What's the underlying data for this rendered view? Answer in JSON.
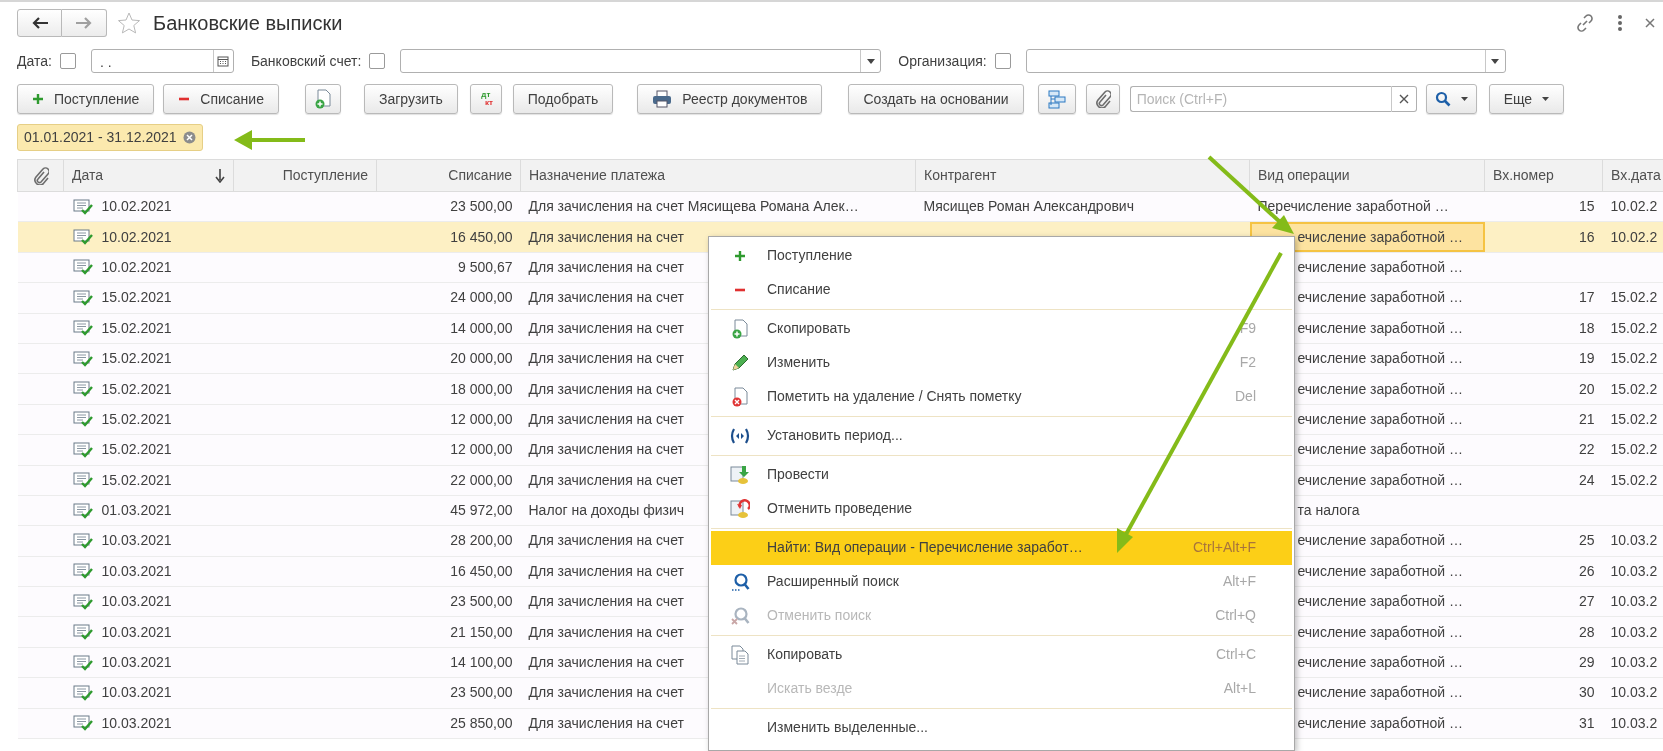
{
  "window": {
    "title": "Банковские выписки",
    "favorite": false
  },
  "nav": [
    {
      "kind": "back",
      "disabled": false
    },
    {
      "kind": "forward",
      "disabled": true
    }
  ],
  "filters": [
    {
      "kind": "date",
      "label": "Дата:",
      "checked": false,
      "value": ". ."
    },
    {
      "kind": "combo",
      "label": "Банковский счет:",
      "checked": false
    },
    {
      "kind": "combo",
      "label": "Организация:",
      "checked": false
    }
  ],
  "toolbar": [
    {
      "kind": "add",
      "label": "Поступление"
    },
    {
      "kind": "remove",
      "label": "Списание"
    },
    {
      "kind": "copy-doc"
    },
    {
      "kind": "text",
      "label": "Загрузить"
    },
    {
      "kind": "dtkt",
      "icon_text": [
        "дт",
        "кт"
      ]
    },
    {
      "kind": "text",
      "label": "Подобрать"
    },
    {
      "kind": "print",
      "label": "Реестр документов"
    },
    {
      "kind": "text",
      "label": "Создать на основании"
    },
    {
      "kind": "structure"
    },
    {
      "kind": "attach"
    },
    {
      "kind": "search",
      "placeholder": "Поиск (Ctrl+F)"
    },
    {
      "kind": "search-menu"
    },
    {
      "kind": "more",
      "label": "Еще"
    }
  ],
  "period_filter": {
    "label": "01.01.2021 - 31.12.2021"
  },
  "table": {
    "columns": [
      {
        "kind": "attach"
      },
      {
        "kind": "text",
        "label": "Дата",
        "sorted": true
      },
      {
        "kind": "text",
        "label": "Поступление"
      },
      {
        "kind": "text",
        "label": "Списание"
      },
      {
        "kind": "text",
        "label": "Назначение платежа"
      },
      {
        "kind": "text",
        "label": "Контрагент"
      },
      {
        "kind": "text",
        "label": "Вид операции"
      },
      {
        "kind": "text",
        "label": "Вх.номер"
      },
      {
        "kind": "text",
        "label": "Вх.дата"
      }
    ],
    "rows": [
      {
        "date": "10.02.2021",
        "debit": "23 500,00",
        "purpose": "Для зачисления на счет Мясищева Романа Алек…",
        "counterparty": "Мясищев Роман Александрович",
        "operation": "Перечисление заработной …",
        "in_number": "15",
        "in_date": "10.02.2",
        "selected": false
      },
      {
        "date": "10.02.2021",
        "debit": "16 450,00",
        "purpose": "Для зачисления на счет",
        "operation": "ечисление заработной …",
        "in_number": "16",
        "in_date": "10.02.2",
        "selected": true
      },
      {
        "date": "10.02.2021",
        "debit": "9 500,67",
        "purpose": "Для зачисления на счет",
        "operation": "ечисление заработной …",
        "selected": false
      },
      {
        "date": "15.02.2021",
        "debit": "24 000,00",
        "purpose": "Для зачисления на счет",
        "operation": "ечисление заработной …",
        "in_number": "17",
        "in_date": "15.02.2",
        "selected": false
      },
      {
        "date": "15.02.2021",
        "debit": "14 000,00",
        "purpose": "Для зачисления на счет",
        "operation": "ечисление заработной …",
        "in_number": "18",
        "in_date": "15.02.2",
        "selected": false
      },
      {
        "date": "15.02.2021",
        "debit": "20 000,00",
        "purpose": "Для зачисления на счет",
        "operation": "ечисление заработной …",
        "in_number": "19",
        "in_date": "15.02.2",
        "selected": false
      },
      {
        "date": "15.02.2021",
        "debit": "18 000,00",
        "purpose": "Для зачисления на счет",
        "operation": "ечисление заработной …",
        "in_number": "20",
        "in_date": "15.02.2",
        "selected": false
      },
      {
        "date": "15.02.2021",
        "debit": "12 000,00",
        "purpose": "Для зачисления на счет",
        "operation": "ечисление заработной …",
        "in_number": "21",
        "in_date": "15.02.2",
        "selected": false
      },
      {
        "date": "15.02.2021",
        "debit": "12 000,00",
        "purpose": "Для зачисления на счет",
        "operation": "ечисление заработной …",
        "in_number": "22",
        "in_date": "15.02.2",
        "selected": false
      },
      {
        "date": "15.02.2021",
        "debit": "22 000,00",
        "purpose": "Для зачисления на счет",
        "operation": "ечисление заработной …",
        "in_number": "24",
        "in_date": "15.02.2",
        "selected": false
      },
      {
        "date": "01.03.2021",
        "debit": "45 972,00",
        "purpose": "Налог на доходы физич",
        "operation": "та налога",
        "selected": false
      },
      {
        "date": "10.03.2021",
        "debit": "28 200,00",
        "purpose": "Для зачисления на счет",
        "operation": "ечисление заработной …",
        "in_number": "25",
        "in_date": "10.03.2",
        "selected": false
      },
      {
        "date": "10.03.2021",
        "debit": "16 450,00",
        "purpose": "Для зачисления на счет",
        "operation": "ечисление заработной …",
        "in_number": "26",
        "in_date": "10.03.2",
        "selected": false
      },
      {
        "date": "10.03.2021",
        "debit": "23 500,00",
        "purpose": "Для зачисления на счет",
        "operation": "ечисление заработной …",
        "in_number": "27",
        "in_date": "10.03.2",
        "selected": false
      },
      {
        "date": "10.03.2021",
        "debit": "21 150,00",
        "purpose": "Для зачисления на счет",
        "operation": "ечисление заработной …",
        "in_number": "28",
        "in_date": "10.03.2",
        "selected": false
      },
      {
        "date": "10.03.2021",
        "debit": "14 100,00",
        "purpose": "Для зачисления на счет",
        "operation": "ечисление заработной …",
        "in_number": "29",
        "in_date": "10.03.2",
        "selected": false
      },
      {
        "date": "10.03.2021",
        "debit": "23 500,00",
        "purpose": "Для зачисления на счет",
        "operation": "ечисление заработной …",
        "in_number": "30",
        "in_date": "10.03.2",
        "selected": false
      },
      {
        "date": "10.03.2021",
        "debit": "25 850,00",
        "purpose": "Для зачисления на счет",
        "operation": "ечисление заработной …",
        "in_number": "31",
        "in_date": "10.03.2",
        "selected": false
      }
    ]
  },
  "context_menu": {
    "groups": [
      [
        {
          "kind": "add",
          "label": "Поступление",
          "selected": false,
          "disabled": false
        },
        {
          "kind": "remove",
          "label": "Списание",
          "selected": false,
          "disabled": false
        }
      ],
      [
        {
          "kind": "copy-doc",
          "label": "Скопировать",
          "shortcut": "F9",
          "selected": false,
          "disabled": false
        },
        {
          "kind": "edit",
          "label": "Изменить",
          "shortcut": "F2",
          "selected": false,
          "disabled": false
        },
        {
          "kind": "delete-mark",
          "label": "Пометить на удаление / Снять пометку",
          "shortcut": "Del",
          "selected": false,
          "disabled": false
        }
      ],
      [
        {
          "kind": "period",
          "label": "Установить период...",
          "selected": false,
          "disabled": false
        }
      ],
      [
        {
          "kind": "post",
          "label": "Провести",
          "selected": false,
          "disabled": false
        },
        {
          "kind": "unpost",
          "label": "Отменить проведение",
          "selected": false,
          "disabled": false
        }
      ],
      [
        {
          "kind": "plain",
          "label": "Найти: Вид операции - Перечисление заработ…",
          "shortcut": "Ctrl+Alt+F",
          "selected": true,
          "disabled": false
        },
        {
          "kind": "search",
          "label": "Расширенный поиск",
          "shortcut": "Alt+F",
          "selected": false,
          "disabled": false
        },
        {
          "kind": "cancel-search",
          "label": "Отменить поиск",
          "shortcut": "Ctrl+Q",
          "selected": false,
          "disabled": true
        }
      ],
      [
        {
          "kind": "copy",
          "label": "Копировать",
          "shortcut": "Ctrl+C",
          "selected": false,
          "disabled": false
        },
        {
          "kind": "plain",
          "label": "Искать везде",
          "shortcut": "Alt+L",
          "selected": false,
          "disabled": true
        }
      ],
      [
        {
          "kind": "plain",
          "label": "Изменить выделенные...",
          "selected": false,
          "disabled": false
        }
      ]
    ]
  }
}
